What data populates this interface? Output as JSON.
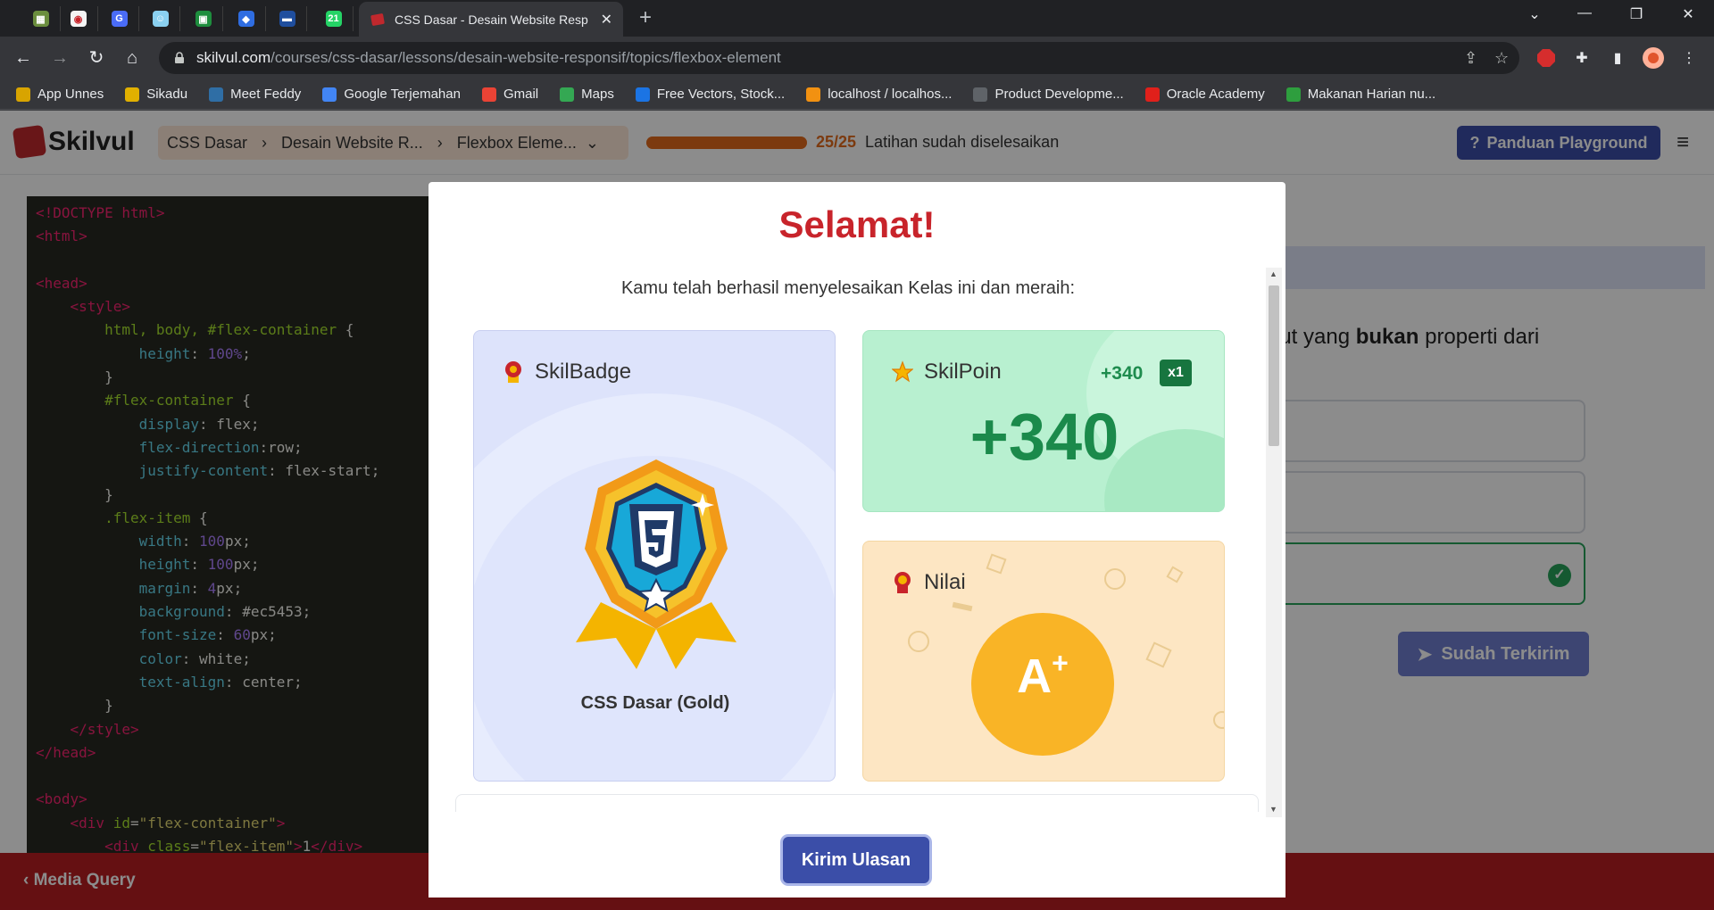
{
  "browser": {
    "active_tab_title": "CSS Dasar - Desain Website Resp",
    "pinned_tabs": [
      {
        "name": "tab-app-1",
        "color": "#6b8e3e",
        "glyph": "▦"
      },
      {
        "name": "tab-app-2",
        "color": "#f4f4f4",
        "glyph": "◉"
      },
      {
        "name": "tab-app-3",
        "color": "#4a6cf7",
        "glyph": "G"
      },
      {
        "name": "tab-app-4",
        "color": "#8ad0f0",
        "glyph": "☺"
      },
      {
        "name": "tab-app-5",
        "color": "#1e8e3e",
        "glyph": "▣"
      },
      {
        "name": "tab-app-6",
        "color": "#2f6de1",
        "glyph": "◆"
      },
      {
        "name": "tab-app-7",
        "color": "#1f4e9e",
        "glyph": "▬"
      },
      {
        "name": "tab-whatsapp",
        "color": "#25d366",
        "glyph": "21"
      }
    ],
    "url_host": "skilvul.com",
    "url_path": "/courses/css-dasar/lessons/desain-website-responsif/topics/flexbox-element",
    "bookmarks": [
      {
        "label": "App Unnes",
        "color": "#d8a400"
      },
      {
        "label": "Sikadu",
        "color": "#e1b000"
      },
      {
        "label": "Meet Feddy",
        "color": "#2f6ea5"
      },
      {
        "label": "Google Terjemahan",
        "color": "#4285f4"
      },
      {
        "label": "Gmail",
        "color": "#ea4335"
      },
      {
        "label": "Maps",
        "color": "#34a853"
      },
      {
        "label": "Free Vectors, Stock...",
        "color": "#1b74e4"
      },
      {
        "label": "localhost / localhos...",
        "color": "#f29111"
      },
      {
        "label": "Product Developme...",
        "color": "#5f6368"
      },
      {
        "label": "Oracle Academy",
        "color": "#e0201b"
      },
      {
        "label": "Makanan Harian nu...",
        "color": "#2e9e3e"
      }
    ]
  },
  "app": {
    "logo": "Skilvul",
    "breadcrumbs": [
      "CSS Dasar",
      "Desain Website R...",
      "Flexbox Eleme..."
    ],
    "progress": {
      "count": "25/25",
      "fraction": 1.0,
      "message": "Latihan sudah diselesaikan"
    },
    "guide_button": "Panduan Playground",
    "question_fragment_a": "ikut yang ",
    "question_fragment_bold": "bukan",
    "question_fragment_b": " properti dari",
    "sent_button": "Sudah Terkirim",
    "footer_prev": "Media Query"
  },
  "code_lines": [
    [
      [
        "c-tag",
        "<!DOCTYPE html>"
      ]
    ],
    [
      [
        "c-tag",
        "<html>"
      ]
    ],
    [],
    [
      [
        "c-tag",
        "<head>"
      ]
    ],
    [
      [
        "c-pl",
        "    "
      ],
      [
        "c-tag",
        "<style>"
      ]
    ],
    [
      [
        "c-pl",
        "        "
      ],
      [
        "c-sel",
        "html, body, #flex-container"
      ],
      [
        "c-pl",
        " {"
      ]
    ],
    [
      [
        "c-pl",
        "            "
      ],
      [
        "c-prop",
        "height"
      ],
      [
        "c-pl",
        ": "
      ],
      [
        "c-val",
        "100%"
      ],
      [
        "c-pl",
        ";"
      ]
    ],
    [
      [
        "c-pl",
        "        }"
      ]
    ],
    [
      [
        "c-pl",
        "        "
      ],
      [
        "c-sel",
        "#flex-container"
      ],
      [
        "c-pl",
        " {"
      ]
    ],
    [
      [
        "c-pl",
        "            "
      ],
      [
        "c-prop",
        "display"
      ],
      [
        "c-pl",
        ": flex;"
      ]
    ],
    [
      [
        "c-pl",
        "            "
      ],
      [
        "c-prop",
        "flex-direction"
      ],
      [
        "c-pl",
        ":row;"
      ]
    ],
    [
      [
        "c-pl",
        "            "
      ],
      [
        "c-prop",
        "justify-content"
      ],
      [
        "c-pl",
        ": flex-start;"
      ]
    ],
    [
      [
        "c-pl",
        "        }"
      ]
    ],
    [
      [
        "c-pl",
        "        "
      ],
      [
        "c-sel",
        ".flex-item"
      ],
      [
        "c-pl",
        " {"
      ]
    ],
    [
      [
        "c-pl",
        "            "
      ],
      [
        "c-prop",
        "width"
      ],
      [
        "c-pl",
        ": "
      ],
      [
        "c-val",
        "100"
      ],
      [
        "c-pl",
        "px;"
      ]
    ],
    [
      [
        "c-pl",
        "            "
      ],
      [
        "c-prop",
        "height"
      ],
      [
        "c-pl",
        ": "
      ],
      [
        "c-val",
        "100"
      ],
      [
        "c-pl",
        "px;"
      ]
    ],
    [
      [
        "c-pl",
        "            "
      ],
      [
        "c-prop",
        "margin"
      ],
      [
        "c-pl",
        ": "
      ],
      [
        "c-val",
        "4"
      ],
      [
        "c-pl",
        "px;"
      ]
    ],
    [
      [
        "c-pl",
        "            "
      ],
      [
        "c-prop",
        "background"
      ],
      [
        "c-pl",
        ": #ec5453;"
      ]
    ],
    [
      [
        "c-pl",
        "            "
      ],
      [
        "c-prop",
        "font-size"
      ],
      [
        "c-pl",
        ": "
      ],
      [
        "c-val",
        "60"
      ],
      [
        "c-pl",
        "px;"
      ]
    ],
    [
      [
        "c-pl",
        "            "
      ],
      [
        "c-prop",
        "color"
      ],
      [
        "c-pl",
        ": white;"
      ]
    ],
    [
      [
        "c-pl",
        "            "
      ],
      [
        "c-prop",
        "text-align"
      ],
      [
        "c-pl",
        ": center;"
      ]
    ],
    [
      [
        "c-pl",
        "        }"
      ]
    ],
    [
      [
        "c-pl",
        "    "
      ],
      [
        "c-tag",
        "</style>"
      ]
    ],
    [
      [
        "c-tag",
        "</head>"
      ]
    ],
    [],
    [
      [
        "c-tag",
        "<body>"
      ]
    ],
    [
      [
        "c-pl",
        "    "
      ],
      [
        "c-tag",
        "<div "
      ],
      [
        "c-sel",
        "id"
      ],
      [
        "c-pl",
        "="
      ],
      [
        "c-str",
        "\"flex-container\""
      ],
      [
        "c-tag",
        ">"
      ]
    ],
    [
      [
        "c-pl",
        "        "
      ],
      [
        "c-tag",
        "<div "
      ],
      [
        "c-sel",
        "class"
      ],
      [
        "c-pl",
        "="
      ],
      [
        "c-str",
        "\"flex-item\""
      ],
      [
        "c-tag",
        ">"
      ],
      [
        "c-pl",
        "1"
      ],
      [
        "c-tag",
        "</div>"
      ]
    ]
  ],
  "modal": {
    "title": "Selamat!",
    "subtitle": "Kamu telah berhasil menyelesaikan Kelas ini dan meraih:",
    "badge": {
      "heading": "SkilBadge",
      "name": "CSS Dasar (Gold)"
    },
    "poin": {
      "heading": "SkilPoin",
      "plus": "+340",
      "multiplier": "x1",
      "value": "+340"
    },
    "nilai": {
      "heading": "Nilai",
      "grade": "A",
      "grade_sup": "+"
    },
    "review_button": "Kirim Ulasan"
  },
  "colors": {
    "brand_red": "#c8242b",
    "primary_blue": "#3b4ea8",
    "success_green": "#27a35a",
    "progress_orange": "#e26b1d"
  }
}
